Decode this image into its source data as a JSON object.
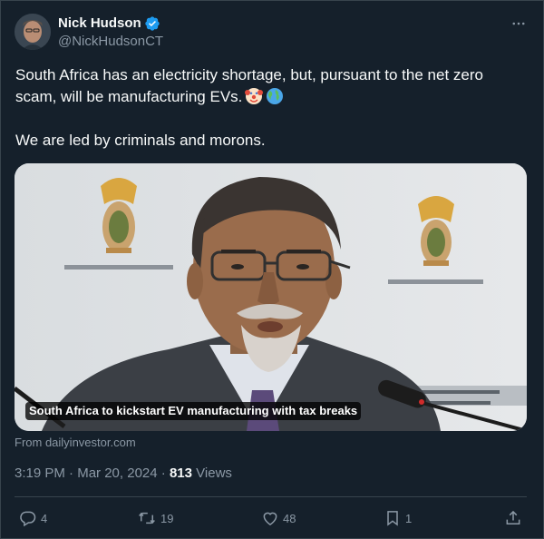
{
  "author": {
    "display_name": "Nick Hudson",
    "handle": "@NickHudsonCT",
    "verified_icon": "verified-badge-icon"
  },
  "menu_icon": "more-dots-icon",
  "post": {
    "line1": "South Africa has an electricity shortage, but, pursuant to the net zero scam, will be manufacturing EVs.",
    "emojis": [
      "clown-face-emoji",
      "globe-emoji"
    ],
    "line2": "We are led by criminals and morons."
  },
  "card": {
    "headline": "South Africa to kickstart EV manufacturing with tax breaks",
    "source": "From dailyinvestor.com"
  },
  "meta": {
    "time": "3:19 PM",
    "sep1": "·",
    "date": "Mar 20, 2024",
    "sep2": "·",
    "views_count": "813",
    "views_label": "Views"
  },
  "actions": {
    "reply_count": "4",
    "repost_count": "19",
    "like_count": "48",
    "bookmark_count": "1"
  },
  "colors": {
    "background": "#15202b",
    "text": "#f7f9f9",
    "muted": "#8b98a5",
    "border": "#38444d",
    "verified": "#1d9bf0"
  }
}
